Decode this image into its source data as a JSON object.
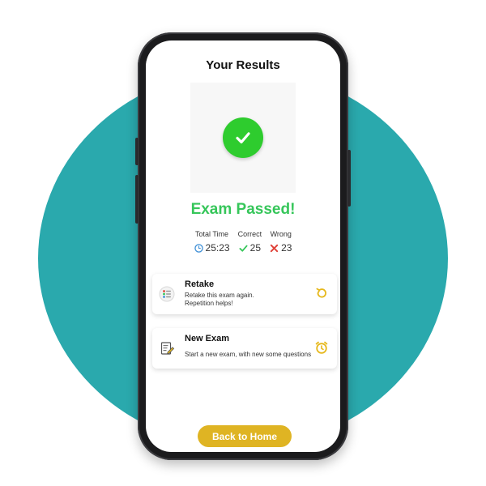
{
  "screen": {
    "title": "Your Results",
    "status": "Exam Passed!",
    "stats": [
      {
        "label": "Total Time",
        "value": "25:23",
        "icon": "clock-icon"
      },
      {
        "label": "Correct",
        "value": "25",
        "icon": "check-icon"
      },
      {
        "label": "Wrong",
        "value": "23",
        "icon": "cross-icon"
      }
    ],
    "cards": [
      {
        "title": "Retake",
        "desc": "Retake this exam again.\nRepetition helps!",
        "icon": "checklist-icon",
        "action_icon": "retry-icon"
      },
      {
        "title": "New Exam",
        "desc": "Start a new exam, with new some questions",
        "icon": "edit-document-icon",
        "action_icon": "alarm-clock-icon"
      }
    ],
    "home_button": "Back to Home"
  },
  "colors": {
    "accent_green": "#36c65a",
    "check_circle": "#2ecc2e",
    "home_button": "#dfb423",
    "background_circle": "#2aa9ad",
    "wrong_red": "#e0433a",
    "clock_blue": "#3e8fd6",
    "action_yellow": "#e6b81c"
  }
}
